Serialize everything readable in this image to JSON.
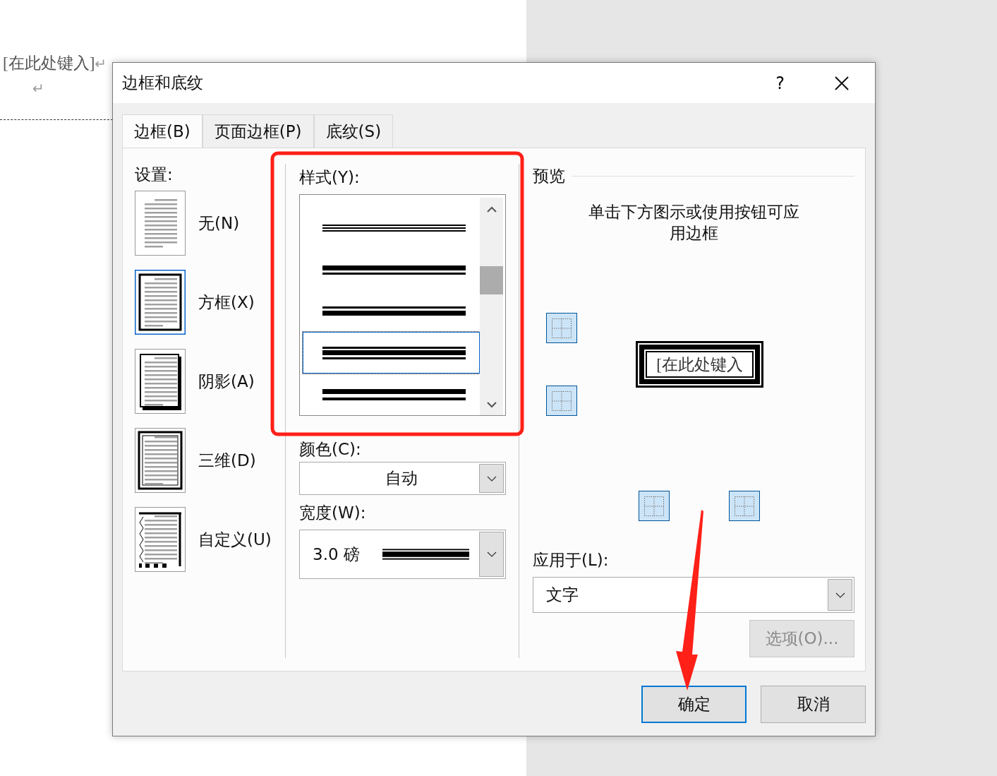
{
  "document": {
    "text": "[在此处键入]",
    "marks": [
      "↵",
      "↵"
    ]
  },
  "dialog": {
    "title": "边框和底纹",
    "help": "?"
  },
  "tabs": [
    {
      "label": "边框(B)",
      "selected": true
    },
    {
      "label": "页面边框(P)",
      "selected": false
    },
    {
      "label": "底纹(S)",
      "selected": false
    }
  ],
  "settings": {
    "label": "设置:",
    "items": [
      {
        "label": "无(N)",
        "kind": "none",
        "selected": false
      },
      {
        "label": "方框(X)",
        "kind": "box",
        "selected": true
      },
      {
        "label": "阴影(A)",
        "kind": "shadow",
        "selected": false
      },
      {
        "label": "三维(D)",
        "kind": "raised",
        "selected": false
      },
      {
        "label": "自定义(U)",
        "kind": "custom",
        "selected": false
      }
    ]
  },
  "style": {
    "label": "样式(Y):",
    "options": [
      {
        "kind": "triple",
        "selected": false
      },
      {
        "kind": "thick-thin",
        "selected": false
      },
      {
        "kind": "thin-thick",
        "selected": false
      },
      {
        "kind": "thin-thick-thin",
        "selected": true
      },
      {
        "kind": "thick-thin-wide",
        "selected": false
      }
    ]
  },
  "color": {
    "label": "颜色(C):",
    "value": "自动"
  },
  "width": {
    "label": "宽度(W):",
    "value": "3.0 磅"
  },
  "preview": {
    "label": "预览",
    "hint": "单击下方图示或使用按钮可应用边框",
    "sample_text": "[在此处键入",
    "border_buttons": [
      {
        "kind": "top",
        "on": true
      },
      {
        "kind": "bottom",
        "on": true
      },
      {
        "kind": "left",
        "on": true
      },
      {
        "kind": "right",
        "on": true
      }
    ]
  },
  "apply_to": {
    "label": "应用于(L):",
    "value": "文字"
  },
  "options_button": {
    "label": "选项(O)...",
    "disabled": true
  },
  "ok_button": {
    "label": "确定",
    "focused": true
  },
  "cancel_button": {
    "label": "取消",
    "focused": false
  },
  "annotations": {
    "highlight_rectangle": true,
    "arrow": true
  }
}
